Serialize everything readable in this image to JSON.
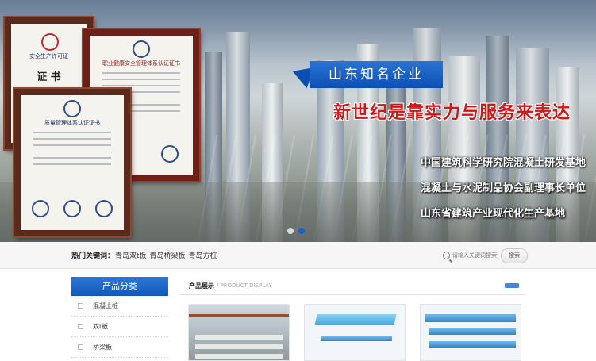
{
  "banner": {
    "certificates": [
      {
        "heading": "安全生产许可证",
        "main_text": "证 书"
      },
      {
        "heading": "职业健康安全管理体系认证证书",
        "main_text": ""
      },
      {
        "heading": "质量管理体系认证证书",
        "main_text": ""
      }
    ],
    "callout": "山东知名企业",
    "slogan": "新世纪是靠实力与服务来表达",
    "honors": [
      "中国建筑科学研究院混凝土研发基地",
      "混凝土与水泥制品协会副理事长单位",
      "山东省建筑产业现代化生产基地"
    ],
    "slide_count": 2,
    "active_slide": 1
  },
  "keywords": {
    "label": "热门关键词：",
    "links": [
      "青岛双t板",
      "青岛桥梁板",
      "青岛方桩"
    ]
  },
  "search": {
    "placeholder": "请输入关键词搜索",
    "button_label": "搜索"
  },
  "sidebar": {
    "title": "产品分类",
    "items": [
      {
        "label": "混凝土桩"
      },
      {
        "label": "双t板"
      },
      {
        "label": "桥梁板"
      }
    ]
  },
  "products": {
    "title": "产品展示",
    "subtitle": "/ PRODUCT DISPLAY",
    "accent_color": "#1a5fc7"
  }
}
